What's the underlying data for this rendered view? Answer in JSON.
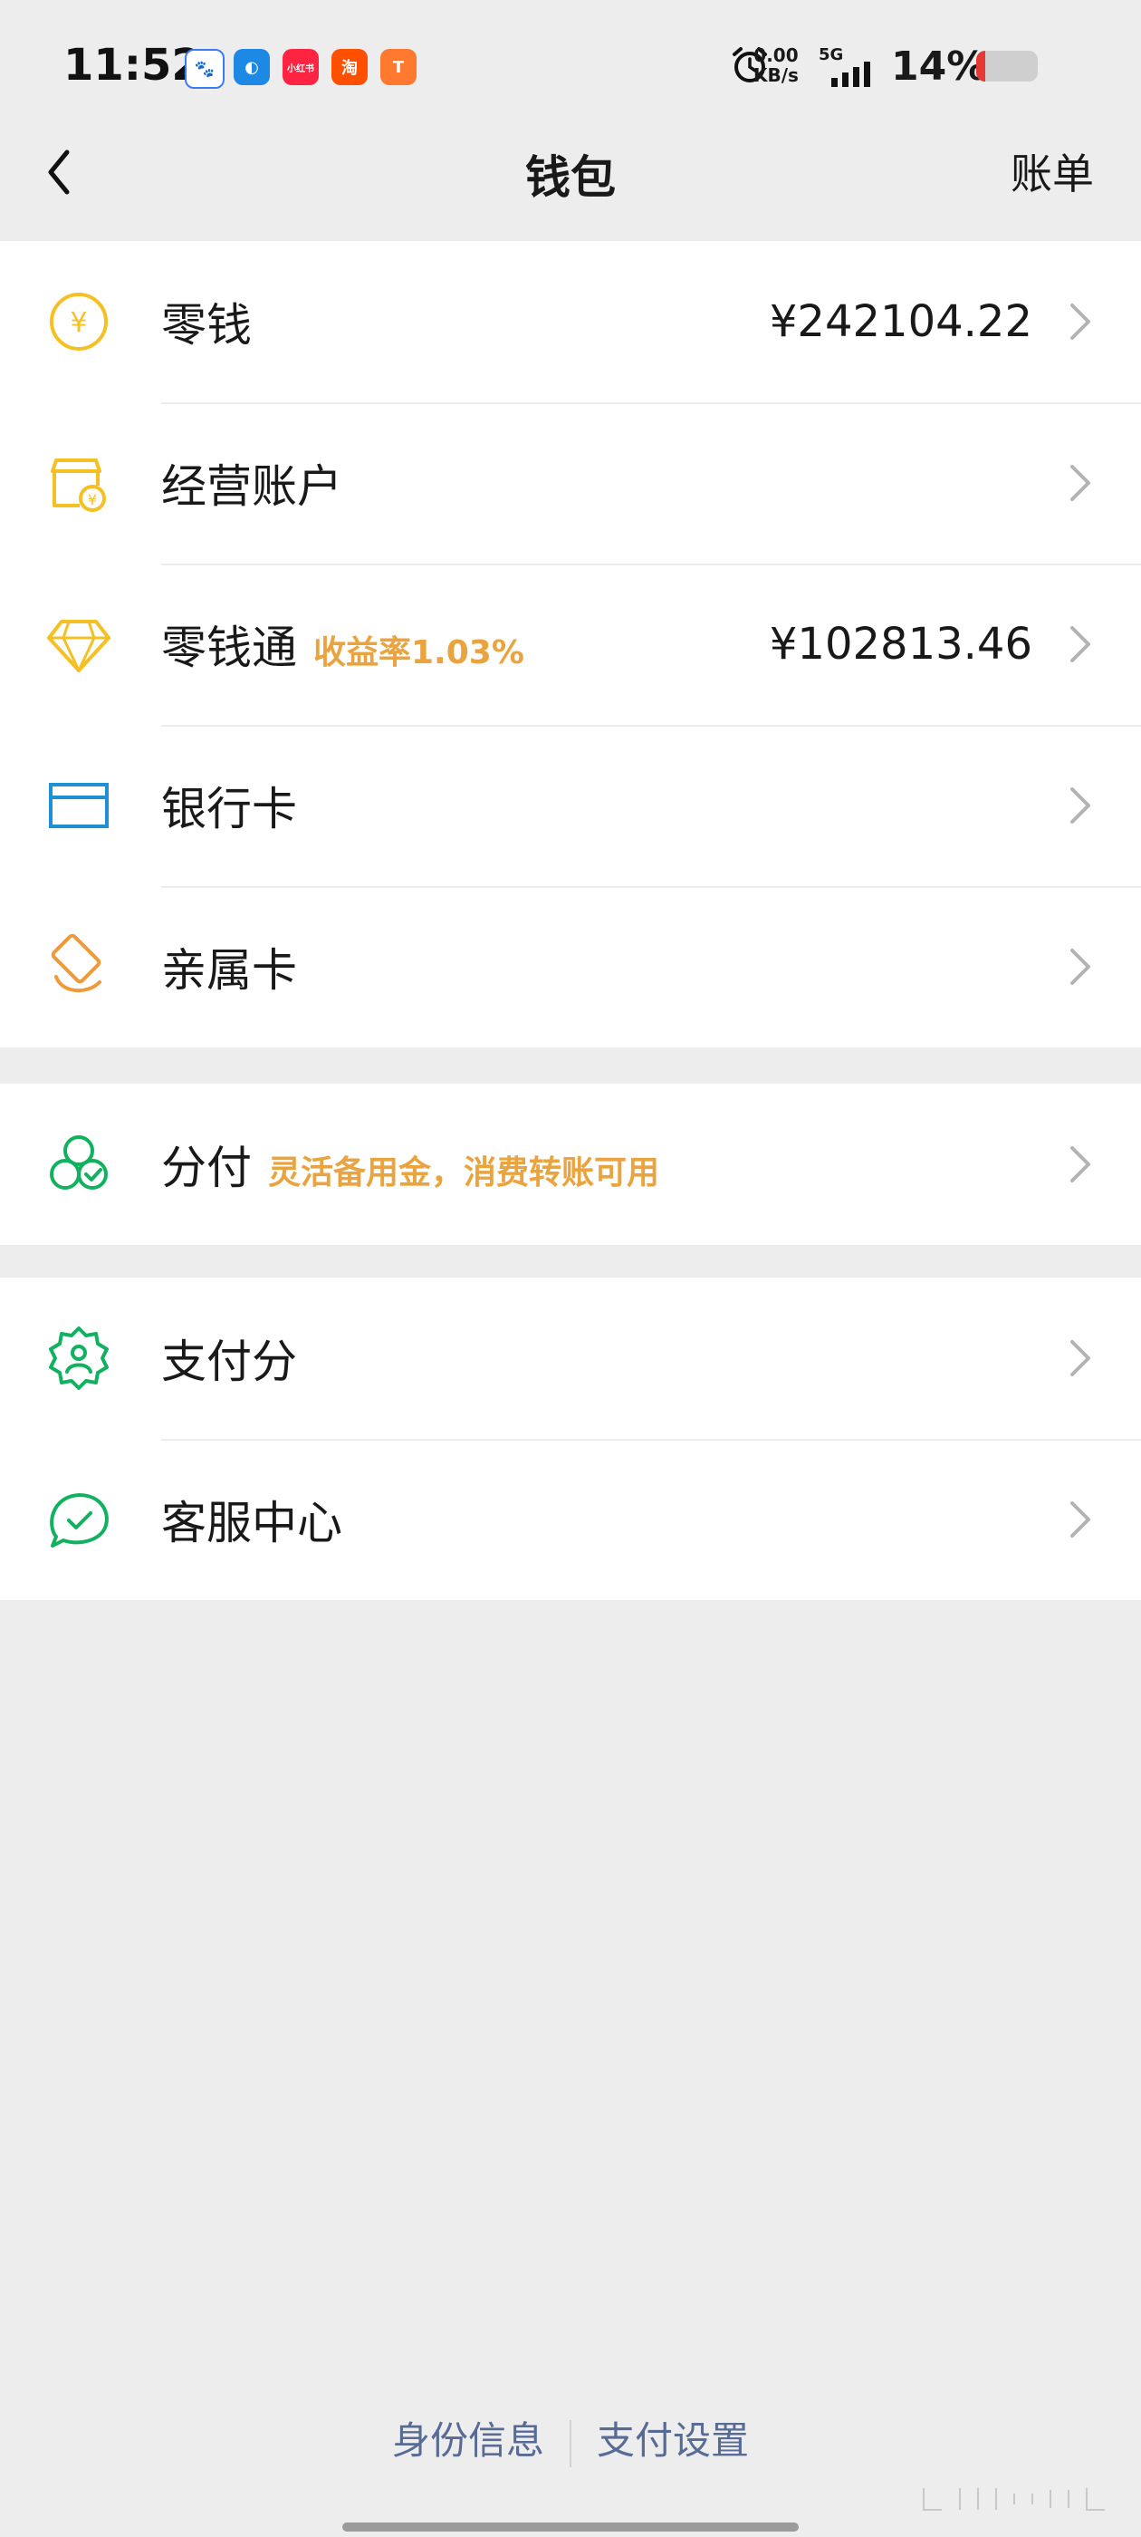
{
  "status_bar": {
    "time": "11:52",
    "apps": [
      {
        "name": "baidu-icon",
        "color": "#3b7cf6",
        "glyph": "🐾"
      },
      {
        "name": "browser-icon",
        "color": "#1e88e5",
        "glyph": "◐"
      },
      {
        "name": "xiaohongshu-icon",
        "color": "#ff2442",
        "glyph": "小红书"
      },
      {
        "name": "taobao-icon",
        "color": "#ff5000",
        "glyph": "淘"
      },
      {
        "name": "app-icon-orange",
        "color": "#ff7a2f",
        "glyph": "T"
      }
    ],
    "speed_top": "0.00",
    "speed_bottom": "KB/s",
    "network": "5G",
    "battery": "14%",
    "battery_level": 0.14
  },
  "nav": {
    "title": "钱包",
    "right": "账单"
  },
  "wallet_items": [
    {
      "label": "零钱",
      "value": "¥242104.22",
      "sub": ""
    },
    {
      "label": "经营账户",
      "value": "",
      "sub": ""
    },
    {
      "label": "零钱通",
      "value": "¥102813.46",
      "sub": "收益率1.03%"
    },
    {
      "label": "银行卡",
      "value": "",
      "sub": ""
    },
    {
      "label": "亲属卡",
      "value": "",
      "sub": ""
    }
  ],
  "credit_items": [
    {
      "label": "分付",
      "sub": "灵活备用金，消费转账可用"
    }
  ],
  "service_items": [
    {
      "label": "支付分"
    },
    {
      "label": "客服中心"
    }
  ],
  "footer": {
    "left": "身份信息",
    "right": "支付设置"
  },
  "colors": {
    "accent_orange": "#e9a33f",
    "icon_yellow": "#f4c024",
    "icon_blue": "#1f8fd6",
    "icon_green": "#11b160",
    "link_blue": "#576b95"
  }
}
